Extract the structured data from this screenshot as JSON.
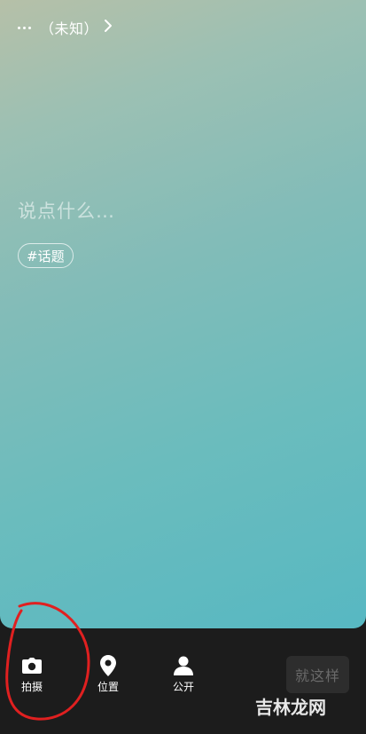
{
  "topbar": {
    "label": "（未知）",
    "more_icon": "more-dots-icon",
    "chevron_icon": "chevron-right-icon"
  },
  "composer": {
    "placeholder": "说点什么…",
    "topic_chip": "#话题"
  },
  "toolbar": {
    "photo_label": "拍摄",
    "location_label": "位置",
    "visibility_label": "公开",
    "submit_label": "就这样"
  },
  "annotation": {
    "circle_color": "#e02020"
  },
  "watermark": {
    "text": "吉林龙网"
  }
}
